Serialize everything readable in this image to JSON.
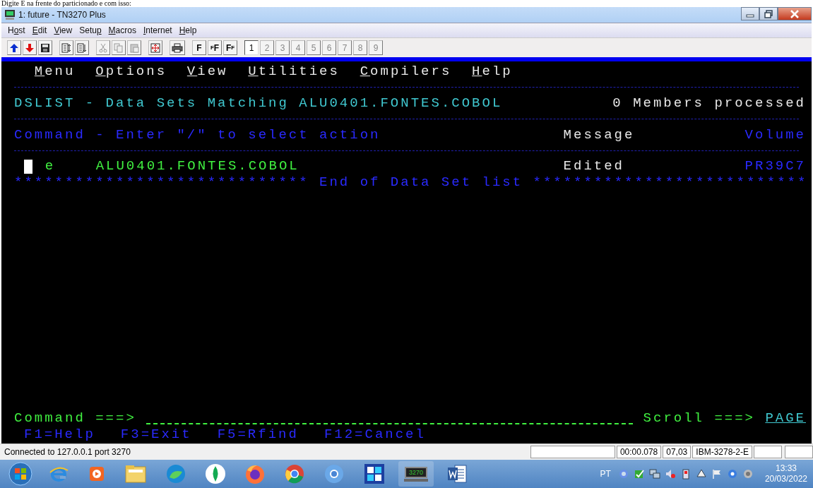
{
  "document_text": "Digite E na frente do particionado e com isso:",
  "window": {
    "title": "1: future - TN3270 Plus"
  },
  "menu": [
    {
      "before": "H",
      "key": "o",
      "after": "st"
    },
    {
      "key": "E",
      "after": "dit"
    },
    {
      "key": "V",
      "after": "iew"
    },
    {
      "before": "Setu",
      "key": "p"
    },
    {
      "key": "M",
      "after": "acros"
    },
    {
      "key": "I",
      "after": "nternet"
    },
    {
      "key": "H",
      "after": "elp"
    }
  ],
  "toolbar": {
    "font_buttons": [
      {
        "label": "F",
        "kind": "plain"
      },
      {
        "label": "FF",
        "kind": "small-large"
      },
      {
        "label": "FF",
        "kind": "large-small"
      }
    ],
    "sessions": [
      {
        "label": "1",
        "selected": true
      },
      {
        "label": "2",
        "selected": false
      },
      {
        "label": "3",
        "selected": false
      },
      {
        "label": "4",
        "selected": false
      },
      {
        "label": "5",
        "selected": false
      },
      {
        "label": "6",
        "selected": false
      },
      {
        "label": "7",
        "selected": false
      },
      {
        "label": "8",
        "selected": false
      },
      {
        "label": "9",
        "selected": false
      }
    ]
  },
  "terminal": {
    "menu": [
      {
        "key": "M",
        "after": "enu"
      },
      {
        "key": "O",
        "after": "ptions"
      },
      {
        "key": "V",
        "after": "iew"
      },
      {
        "key": "U",
        "after": "tilities"
      },
      {
        "key": "C",
        "after": "ompilers"
      },
      {
        "key": "H",
        "after": "elp"
      }
    ],
    "title": "DSLIST - Data Sets Matching ALU0401.FONTES.COBOL",
    "status": "0 Members processed",
    "header": {
      "command": "Command - Enter \"/\" to select action",
      "message": "Message",
      "volume": "Volume"
    },
    "rows": [
      {
        "command": "e",
        "dataset": "ALU0401.FONTES.COBOL",
        "message": "Edited",
        "volume": "PR39C7"
      }
    ],
    "end_line": {
      "left": "*****************************",
      "text": "End of Data Set list",
      "right": "***************************"
    },
    "command_label": "Command ===>",
    "scroll_label": "Scroll ===>",
    "scroll_value": "PAGE",
    "function_keys": [
      "F1=Help",
      "F3=Exit",
      "F5=Rfind",
      "F12=Cancel"
    ]
  },
  "status_bar": {
    "message": "Connected to 127.0.0.1 port 3270",
    "fields": [
      "00:00.078",
      "07,03",
      "IBM-3278-2-E"
    ]
  },
  "taskbar": {
    "language": "PT",
    "time": "13:33",
    "date": "20/03/2022",
    "app_label": "3270"
  }
}
